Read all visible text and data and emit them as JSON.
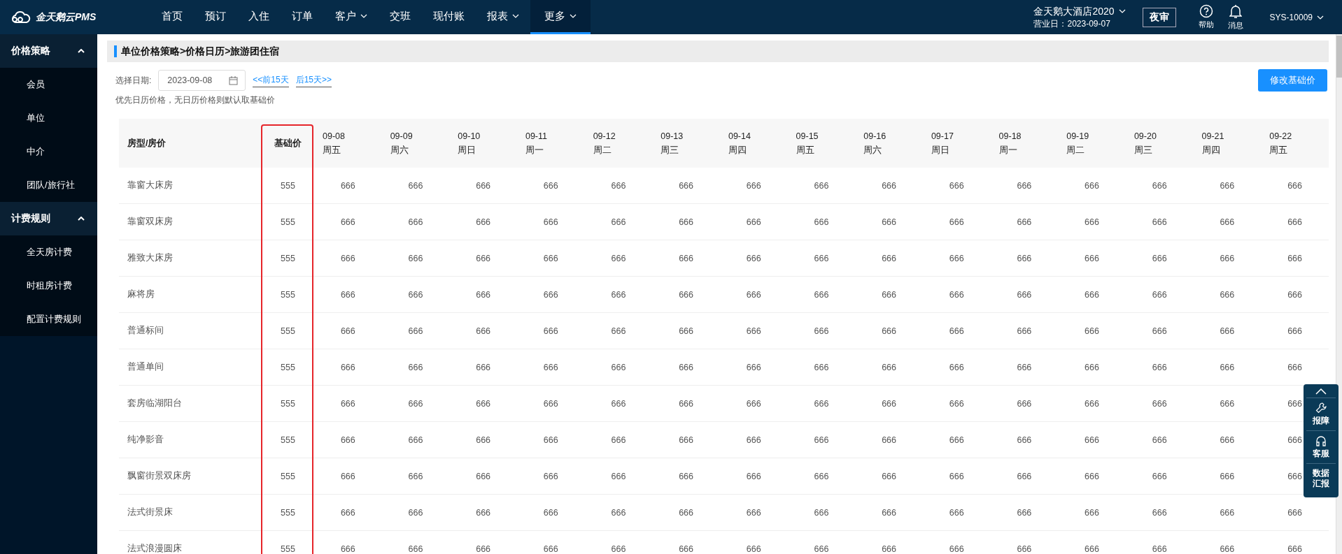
{
  "brand": {
    "name": "金天鹅云PMS"
  },
  "nav": [
    {
      "label": "首页",
      "dropdown": false,
      "selected": false
    },
    {
      "label": "预订",
      "dropdown": false,
      "selected": false
    },
    {
      "label": "入住",
      "dropdown": false,
      "selected": false
    },
    {
      "label": "订单",
      "dropdown": false,
      "selected": false
    },
    {
      "label": "客户",
      "dropdown": true,
      "selected": false
    },
    {
      "label": "交班",
      "dropdown": false,
      "selected": false
    },
    {
      "label": "现付账",
      "dropdown": false,
      "selected": false
    },
    {
      "label": "报表",
      "dropdown": true,
      "selected": false
    },
    {
      "label": "更多",
      "dropdown": true,
      "selected": true
    }
  ],
  "hotel": {
    "name": "金天鹅大酒店2020",
    "business_date": "营业日：2023-09-07"
  },
  "night_audit_button": "夜审",
  "help": "帮助",
  "messages": "消息",
  "user": "SYS-10009",
  "sidebar": [
    {
      "label": "价格策略",
      "expanded": true,
      "items": [
        "会员",
        "单位",
        "中介",
        "团队/旅行社"
      ]
    },
    {
      "label": "计费规则",
      "expanded": true,
      "items": [
        "全天房计费",
        "时租房计费",
        "配置计费规则"
      ]
    }
  ],
  "breadcrumb": "单位价格策略>价格日历>旅游团住宿",
  "date_picker": {
    "label": "选择日期:",
    "value": "2023-09-08"
  },
  "prev_link": "<<前15天",
  "next_link": "后15天>>",
  "hint": "优先日历价格，无日历价格则默认取基础价",
  "edit_base_button": "修改基础价",
  "table": {
    "room_column": "房型/房价",
    "base_column": "基础价",
    "dates": [
      {
        "date": "09-08",
        "weekday": "周五"
      },
      {
        "date": "09-09",
        "weekday": "周六"
      },
      {
        "date": "09-10",
        "weekday": "周日"
      },
      {
        "date": "09-11",
        "weekday": "周一"
      },
      {
        "date": "09-12",
        "weekday": "周二"
      },
      {
        "date": "09-13",
        "weekday": "周三"
      },
      {
        "date": "09-14",
        "weekday": "周四"
      },
      {
        "date": "09-15",
        "weekday": "周五"
      },
      {
        "date": "09-16",
        "weekday": "周六"
      },
      {
        "date": "09-17",
        "weekday": "周日"
      },
      {
        "date": "09-18",
        "weekday": "周一"
      },
      {
        "date": "09-19",
        "weekday": "周二"
      },
      {
        "date": "09-20",
        "weekday": "周三"
      },
      {
        "date": "09-21",
        "weekday": "周四"
      },
      {
        "date": "09-22",
        "weekday": "周五"
      }
    ],
    "rows": [
      {
        "room": "靠窗大床房",
        "base": "555",
        "prices": [
          "666",
          "666",
          "666",
          "666",
          "666",
          "666",
          "666",
          "666",
          "666",
          "666",
          "666",
          "666",
          "666",
          "666",
          "666"
        ]
      },
      {
        "room": "靠窗双床房",
        "base": "555",
        "prices": [
          "666",
          "666",
          "666",
          "666",
          "666",
          "666",
          "666",
          "666",
          "666",
          "666",
          "666",
          "666",
          "666",
          "666",
          "666"
        ]
      },
      {
        "room": "雅致大床房",
        "base": "555",
        "prices": [
          "666",
          "666",
          "666",
          "666",
          "666",
          "666",
          "666",
          "666",
          "666",
          "666",
          "666",
          "666",
          "666",
          "666",
          "666"
        ]
      },
      {
        "room": "麻将房",
        "base": "555",
        "prices": [
          "666",
          "666",
          "666",
          "666",
          "666",
          "666",
          "666",
          "666",
          "666",
          "666",
          "666",
          "666",
          "666",
          "666",
          "666"
        ]
      },
      {
        "room": "普通标间",
        "base": "555",
        "prices": [
          "666",
          "666",
          "666",
          "666",
          "666",
          "666",
          "666",
          "666",
          "666",
          "666",
          "666",
          "666",
          "666",
          "666",
          "666"
        ]
      },
      {
        "room": "普通单间",
        "base": "555",
        "prices": [
          "666",
          "666",
          "666",
          "666",
          "666",
          "666",
          "666",
          "666",
          "666",
          "666",
          "666",
          "666",
          "666",
          "666",
          "666"
        ]
      },
      {
        "room": "套房临湖阳台",
        "base": "555",
        "prices": [
          "666",
          "666",
          "666",
          "666",
          "666",
          "666",
          "666",
          "666",
          "666",
          "666",
          "666",
          "666",
          "666",
          "666",
          "666"
        ]
      },
      {
        "room": "纯净影音",
        "base": "555",
        "prices": [
          "666",
          "666",
          "666",
          "666",
          "666",
          "666",
          "666",
          "666",
          "666",
          "666",
          "666",
          "666",
          "666",
          "666",
          "666"
        ]
      },
      {
        "room": "飘窗街景双床房",
        "base": "555",
        "prices": [
          "666",
          "666",
          "666",
          "666",
          "666",
          "666",
          "666",
          "666",
          "666",
          "666",
          "666",
          "666",
          "666",
          "666",
          "666"
        ]
      },
      {
        "room": "法式街景床",
        "base": "555",
        "prices": [
          "666",
          "666",
          "666",
          "666",
          "666",
          "666",
          "666",
          "666",
          "666",
          "666",
          "666",
          "666",
          "666",
          "666",
          "666"
        ]
      },
      {
        "room": "法式浪漫圆床",
        "base": "555",
        "prices": [
          "666",
          "666",
          "666",
          "666",
          "666",
          "666",
          "666",
          "666",
          "666",
          "666",
          "666",
          "666",
          "666",
          "666",
          "666"
        ]
      }
    ]
  },
  "float_tools": {
    "items": [
      "报障",
      "客服",
      "数据汇报"
    ]
  }
}
